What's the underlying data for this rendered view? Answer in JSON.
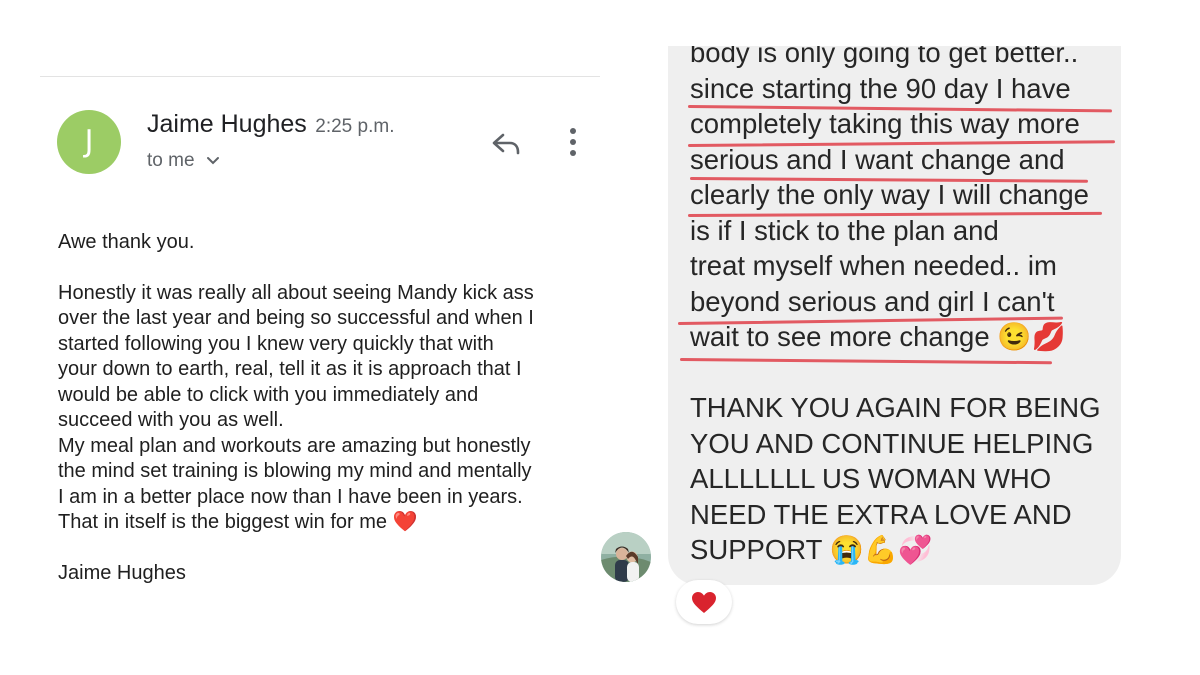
{
  "email": {
    "sender_initial": "J",
    "sender_name": "Jaime Hughes",
    "time": "2:25 p.m.",
    "recipient": "to me",
    "avatar_color": "#9ccc65",
    "icons": {
      "reply": "reply-icon",
      "more": "more-vert-icon",
      "expand": "chevron-down-icon"
    },
    "body": {
      "greeting": "Awe thank you.",
      "paragraph1": "Honestly it was really all about seeing Mandy kick ass\nover the last year and being so successful and when I\nstarted following you I knew very quickly that with\nyour down to earth, real, tell it as it is approach that I\nwould be able to click with you immediately and\nsucceed with you as well.\nMy meal plan and workouts are amazing but honestly\nthe mind set training is blowing my mind and mentally\nI am in a better place now than I have been in years.\nThat in itself is the biggest win for me ❤️",
      "signature": "Jaime Hughes"
    }
  },
  "chat": {
    "avatar_icon": "profile-photo",
    "bubble_color": "#efefef",
    "underline_color": "#e25a62",
    "message_lines": [
      "body is only going to get better..",
      "since starting the 90 day I have",
      "completely taking this way more",
      "serious and I want change and",
      "clearly the only way I will change",
      "is if I stick to the plan and",
      "treat myself when needed.. im",
      "beyond serious and girl I can't",
      "wait to see more change 😉💋"
    ],
    "message_lines_2": [
      "THANK YOU AGAIN FOR BEING",
      "YOU AND CONTINUE HELPING",
      "ALLLLLLL US WOMAN WHO",
      "NEED THE EXTRA LOVE AND",
      "SUPPORT 😭💪💞"
    ],
    "reaction": "❤️"
  }
}
